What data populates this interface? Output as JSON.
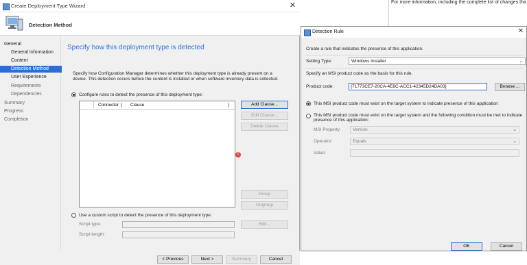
{
  "wizard": {
    "title": "Create Deployment Type Wizard",
    "header_title": "Detection Method",
    "nav": [
      {
        "label": "General"
      },
      {
        "label": "General Information"
      },
      {
        "label": "Content"
      },
      {
        "label": "Detection Method"
      },
      {
        "label": "User Experience"
      },
      {
        "label": "Requirements"
      },
      {
        "label": "Dependencies"
      },
      {
        "label": "Summary"
      },
      {
        "label": "Progress"
      },
      {
        "label": "Completion"
      }
    ],
    "heading": "Specify how this deployment type is detected",
    "description": "Specify how Configuration Manager determines whether this deployment type is already present on a device. This detection occurs before the content is installed or when software inventory data is collected.",
    "radio_rules": "Configure rules to detect the presence of this deployment type:",
    "grid_columns": {
      "connector": "Connector",
      "open_paren": "(",
      "clause": "Clause",
      "close_paren": ")"
    },
    "buttons": {
      "add_clause": "Add Clause...",
      "edit_clause": "Edit Clause...",
      "delete_clause": "Delete Clause",
      "group": "Group",
      "ungroup": "Ungroup",
      "edit": "Edit...",
      "previous": "< Previous",
      "next": "Next >",
      "summary": "Summary",
      "cancel": "Cancel"
    },
    "radio_script": "Use a custom script to detect the presence of this deployment type:",
    "script_type_label": "Script type:",
    "script_length_label": "Script length:",
    "error_glyph": "!"
  },
  "background_doc": {
    "text": "For more information, including the complete list of changes tha"
  },
  "dialog": {
    "title": "Detection Rule",
    "intro": "Create a rule that indicates the presence of this application.",
    "setting_type_label": "Setting Type:",
    "setting_type_value": "Windows Installer",
    "msi_intro": "Specify an MSI product code as the basis for this rule.",
    "product_code_label": "Product code:",
    "product_code_value": "{71773CE7-20CA-4E8C-ACC1-42345D24DA03}",
    "browse_label": "Browse ...",
    "radio_exist": "This MSI product code must exist on the target system to indicate presence of this application",
    "radio_condition": "This MSI product code must exist on the target system and the following condition must be met to indicate presence of this application:",
    "msi_property_label": "MSI Property:",
    "msi_property_value": "Version",
    "operator_label": "Operator:",
    "operator_value": "Equals",
    "value_label": "Value:",
    "ok_label": "OK",
    "cancel_label": "Cancel",
    "close_glyph": "✕"
  },
  "icons": {
    "chevron": "⌄",
    "close": "✕"
  },
  "colors": {
    "accent": "#2a6fd6",
    "error": "#e04343"
  }
}
